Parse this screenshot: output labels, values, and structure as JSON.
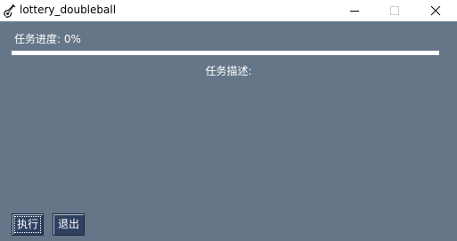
{
  "window": {
    "title": "lottery_doubleball",
    "icon": "guitar-icon"
  },
  "controls": {
    "minimize_icon": "minimize-icon",
    "maximize_icon": "maximize-icon",
    "close_icon": "close-icon"
  },
  "task": {
    "progress_label": "任务进度:   0%",
    "progress_value": 0,
    "description_label": "任务描述:"
  },
  "buttons": {
    "run_label": "执行",
    "exit_label": "退出"
  },
  "colors": {
    "background": "#657689",
    "button": "#2f4060"
  }
}
